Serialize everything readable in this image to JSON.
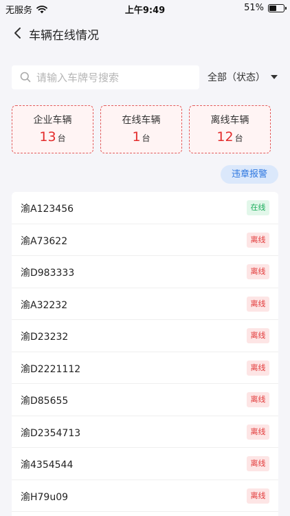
{
  "status_bar": {
    "carrier": "无服务",
    "time": "上午9:49",
    "battery_percent": "51%",
    "battery_level": 0.51
  },
  "nav": {
    "title": "车辆在线情况",
    "back_icon": "chevron-left-icon"
  },
  "search": {
    "placeholder": "请输入车牌号搜索",
    "value": ""
  },
  "filter": {
    "label": "全部（状态）"
  },
  "stats": [
    {
      "label": "企业车辆",
      "value": "13",
      "unit": "台"
    },
    {
      "label": "在线车辆",
      "value": "1",
      "unit": "台"
    },
    {
      "label": "离线车辆",
      "value": "12",
      "unit": "台"
    }
  ],
  "violation_button": "违章报警",
  "vehicles": [
    {
      "plate": "渝A123456",
      "status": "在线",
      "online": true
    },
    {
      "plate": "渝A73622",
      "status": "离线",
      "online": false
    },
    {
      "plate": "渝D983333",
      "status": "离线",
      "online": false
    },
    {
      "plate": "渝A32232",
      "status": "离线",
      "online": false
    },
    {
      "plate": "渝D23232",
      "status": "离线",
      "online": false
    },
    {
      "plate": "渝D2221112",
      "status": "离线",
      "online": false
    },
    {
      "plate": "渝D85655",
      "status": "离线",
      "online": false
    },
    {
      "plate": "渝D2354713",
      "status": "离线",
      "online": false
    },
    {
      "plate": "渝4354544",
      "status": "离线",
      "online": false
    },
    {
      "plate": "渝H79u09",
      "status": "离线",
      "online": false
    }
  ],
  "colors": {
    "accent_blue": "#2f78e0",
    "online_green": "#1cad5b",
    "offline_red": "#e23b3b",
    "stat_red": "#e32b2b"
  }
}
